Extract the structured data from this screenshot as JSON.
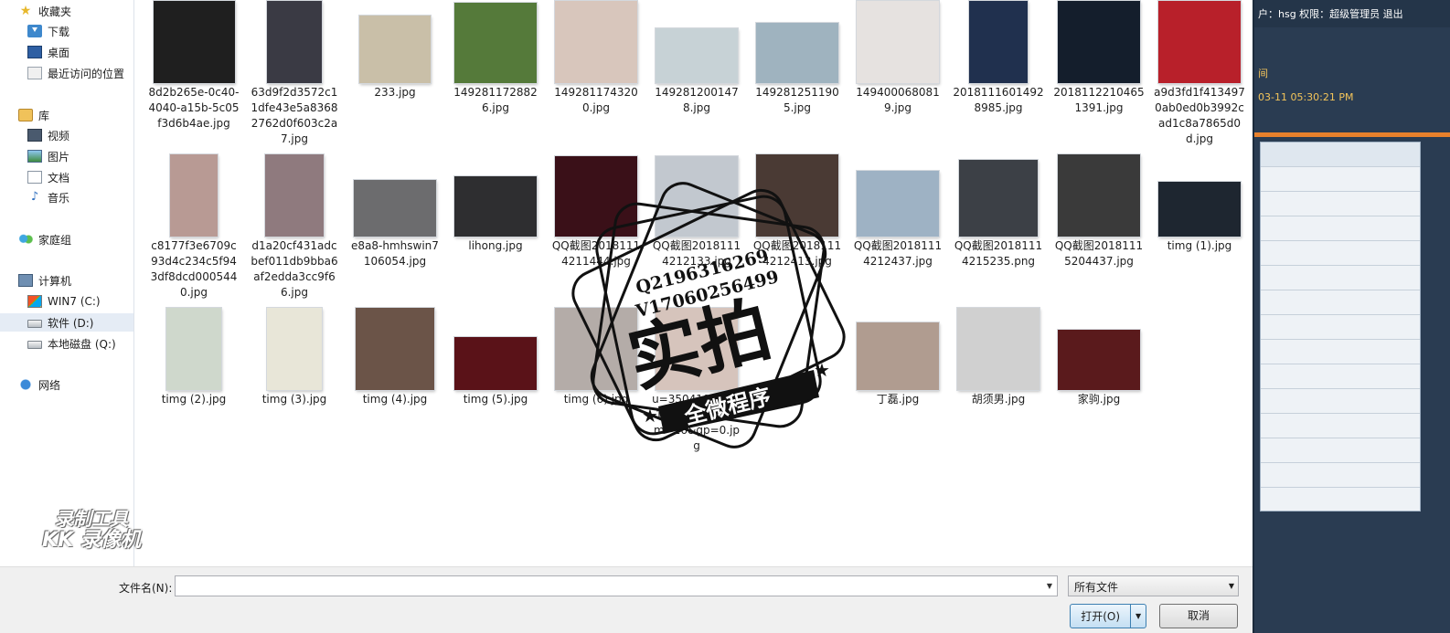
{
  "nav": {
    "items": [
      {
        "label": "收藏夹",
        "icon": "star-icon"
      },
      {
        "label": "下载",
        "icon": "downloads-icon"
      },
      {
        "label": "桌面",
        "icon": "desktop-icon"
      },
      {
        "label": "最近访问的位置",
        "icon": "recent-places-icon"
      },
      {
        "label": "库",
        "icon": "library-icon"
      },
      {
        "label": "视频",
        "icon": "video-icon"
      },
      {
        "label": "图片",
        "icon": "pictures-icon"
      },
      {
        "label": "文档",
        "icon": "documents-icon"
      },
      {
        "label": "音乐",
        "icon": "music-icon"
      },
      {
        "label": "家庭组",
        "icon": "homegroup-icon"
      },
      {
        "label": "计算机",
        "icon": "computer-icon"
      },
      {
        "label": "WIN7 (C:)",
        "icon": "windows-drive-icon"
      },
      {
        "label": "软件 (D:)",
        "icon": "drive-icon",
        "selected": true
      },
      {
        "label": "本地磁盘 (Q:)",
        "icon": "drive-icon"
      },
      {
        "label": "网络",
        "icon": "network-icon"
      }
    ]
  },
  "files": [
    {
      "name": "8d2b265e-0c40-4040-a15b-5c05f3d6b4ae.jpg",
      "color": "#1f1f1f"
    },
    {
      "name": "63d9f2d3572c11dfe43e5a83682762d0f603c2a7.jpg",
      "color": "#3a3a44"
    },
    {
      "name": "233.jpg",
      "color": "#c9bfa8"
    },
    {
      "name": "1492811728826.jpg",
      "color": "#557a3a"
    },
    {
      "name": "1492811743200.jpg",
      "color": "#d8c6bc"
    },
    {
      "name": "1492812001478.jpg",
      "color": "#c7d2d6"
    },
    {
      "name": "1492812511905.jpg",
      "color": "#9fb3bf"
    },
    {
      "name": "1494000680819.jpg",
      "color": "#e6e2e0"
    },
    {
      "name": "20181116014928985.jpg",
      "color": "#20304e"
    },
    {
      "name": "20181122104651391.jpg",
      "color": "#141e2c"
    },
    {
      "name": "a9d3fd1f4134970ab0ed0b3992cad1c8a7865d0d.jpg",
      "color": "#b8202a"
    },
    {
      "name": "c8177f3e6709c93d4c234c5f943df8dcd0005440.jpg",
      "color": "#b89a94"
    },
    {
      "name": "d1a20cf431adcbef011db9bba6af2edda3cc9f66.jpg",
      "color": "#8f7a7e"
    },
    {
      "name": "e8a8-hmhswin7106054.jpg",
      "color": "#6c6c6e"
    },
    {
      "name": "lihong.jpg",
      "color": "#2e2e30"
    },
    {
      "name": "QQ截图20181114211444.jpg",
      "color": "#3a1018"
    },
    {
      "name": "QQ截图20181114212133.jpg",
      "color": "#c2c8cf"
    },
    {
      "name": "QQ截图20181114212413.jpg",
      "color": "#4a3a34"
    },
    {
      "name": "QQ截图20181114212437.jpg",
      "color": "#9eb2c4"
    },
    {
      "name": "QQ截图20181114215235.png",
      "color": "#3c4046"
    },
    {
      "name": "QQ截图20181115204437.jpg",
      "color": "#3a3a3a"
    },
    {
      "name": "timg (1).jpg",
      "color": "#1e2630"
    },
    {
      "name": "timg (2).jpg",
      "color": "#cfd8cc"
    },
    {
      "name": "timg (3).jpg",
      "color": "#e8e6d8"
    },
    {
      "name": "timg (4).jpg",
      "color": "#6b5448"
    },
    {
      "name": "timg (5).jpg",
      "color": "#5a1218"
    },
    {
      "name": "timg (6).jpg",
      "color": "#b4aca8"
    },
    {
      "name": "u=3504109674,1980742468&fm=26&gp=0.jpg",
      "color": "#d6c4bc"
    },
    {
      "name": "dingyi",
      "color": "#7c7872"
    },
    {
      "name": "丁磊.jpg",
      "color": "#b09c90"
    },
    {
      "name": "胡须男.jpg",
      "color": "#d0d0d0"
    },
    {
      "name": "家驹.jpg",
      "color": "#5a1a1c"
    }
  ],
  "bottom": {
    "filename_label": "文件名(N):",
    "filename_value": "",
    "filetype_value": "所有文件",
    "open_label": "打开(O)",
    "cancel_label": "取消"
  },
  "rightapp": {
    "user_text": "户：hsg  权限：超级管理员  退出",
    "time_label": "间",
    "time_value": "03-11 05:30:21 PM"
  },
  "overlay": {
    "stamp_lines": [
      "Q2196316269",
      "V17060256499"
    ],
    "stamp_main": "实拍",
    "stamp_sub": "全微程序",
    "recorder_lines": [
      "录制工具",
      "KK 录像机"
    ]
  },
  "colors": {
    "selection": "#e5ecf5",
    "right_panel": "#2a3c52",
    "accent_orange": "#e8812c",
    "time_text": "#f4c55a"
  }
}
